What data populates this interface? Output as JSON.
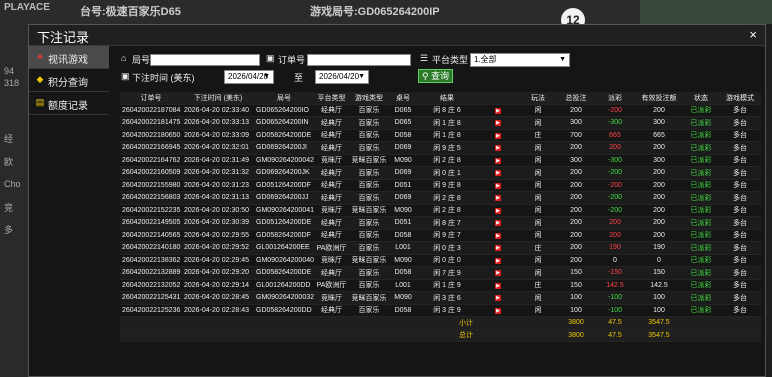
{
  "background": {
    "logo": "PLAYACE",
    "hall_label": "台号:极速百家乐D65",
    "game_label": "游戏局号:GD065264200IP",
    "ball_number": "12",
    "side_texts": [
      "94",
      "318",
      "经",
      "欧",
      "Cho",
      "竞",
      "多"
    ]
  },
  "dialog": {
    "title": "下注记录",
    "close_label": "×"
  },
  "nav": {
    "items": [
      {
        "label": "视讯游戏",
        "icon": "cards-icon",
        "active": true
      },
      {
        "label": "积分查询",
        "icon": "diamond-icon",
        "active": false
      },
      {
        "label": "额度记录",
        "icon": "document-icon",
        "active": false
      }
    ]
  },
  "filters": {
    "game_no_label": "局号",
    "order_no_label": "订单号",
    "platform_type_label": "平台类型",
    "platform_type_value": "1.全部",
    "bet_time_label": "下注时间 (美东)",
    "date_from": "2026/04/20",
    "to_label": "至",
    "date_to": "2026/04/20",
    "query_label": "查询"
  },
  "table": {
    "headers": [
      "订单号",
      "下注时间 (美东)",
      "局号",
      "平台类型",
      "游戏类型",
      "桌号",
      "结果",
      "",
      "玩法",
      "总投注",
      "派彩",
      "有效投注额",
      "状态",
      "游戏模式"
    ],
    "rows": [
      [
        "260420022187084",
        "2026-04-20 02:33:40",
        "GD065264200IO",
        "经典厅",
        "百家乐",
        "D065",
        "闲 8 庄 6",
        "▶",
        "闲",
        "200",
        "-200",
        "200",
        "已派彩",
        "多台",
        "r"
      ],
      [
        "260420022181475",
        "2026-04-20 02:33:13",
        "GD065264200IN",
        "经典厅",
        "百家乐",
        "D065",
        "闲 1 庄 8",
        "▶",
        "闲",
        "300",
        "-300",
        "300",
        "已派彩",
        "多台",
        "g"
      ],
      [
        "260420022180650",
        "2026-04-20 02:33:09",
        "GD058264200DE",
        "经典厅",
        "百家乐",
        "D058",
        "闲 1 庄 8",
        "▶",
        "庄",
        "700",
        "665",
        "665",
        "已派彩",
        "多台",
        "r"
      ],
      [
        "260420022166945",
        "2026-04-20 02:32:01",
        "GD069264200JI",
        "经典厅",
        "百家乐",
        "D069",
        "闲 9 庄 5",
        "▶",
        "闲",
        "200",
        "200",
        "200",
        "已派彩",
        "多台",
        "r"
      ],
      [
        "260420022164762",
        "2026-04-20 02:31:49",
        "GM090264200042",
        "竞眯厅",
        "竞眯百家乐",
        "M090",
        "闲 2 庄 8",
        "▶",
        "闲",
        "300",
        "-300",
        "300",
        "已派彩",
        "多台",
        "g"
      ],
      [
        "260420022160509",
        "2026-04-20 02:31:32",
        "GD069264200JK",
        "经典厅",
        "百家乐",
        "D069",
        "闲 0 庄 1",
        "▶",
        "闲",
        "200",
        "-200",
        "200",
        "已派彩",
        "多台",
        "g"
      ],
      [
        "260420022155980",
        "2026-04-20 02:31:23",
        "GD051264200DF",
        "经典厅",
        "百家乐",
        "D051",
        "闲 9 庄 8",
        "▶",
        "闲",
        "200",
        "-200",
        "200",
        "已派彩",
        "多台",
        "r"
      ],
      [
        "260420022156803",
        "2026-04-20 02:31:13",
        "GD069264200JJ",
        "经典厅",
        "百家乐",
        "D069",
        "闲 2 庄 8",
        "▶",
        "闲",
        "200",
        "-200",
        "200",
        "已派彩",
        "多台",
        "g"
      ],
      [
        "260420022152235",
        "2026-04-20 02:30:50",
        "GM090264200041",
        "竞眯厅",
        "竞眯百家乐",
        "M090",
        "闲 2 庄 8",
        "▶",
        "闲",
        "200",
        "-200",
        "200",
        "已派彩",
        "多台",
        "g"
      ],
      [
        "260420022149505",
        "2026-04-20 02:30:39",
        "GD051264200DE",
        "经典厅",
        "百家乐",
        "D051",
        "闲 8 庄 7",
        "▶",
        "闲",
        "200",
        "200",
        "200",
        "已派彩",
        "多台",
        "r"
      ],
      [
        "260420022140565",
        "2026-04-20 02:29:55",
        "GD058264200DF",
        "经典厅",
        "百家乐",
        "D058",
        "闲 9 庄 7",
        "▶",
        "闲",
        "200",
        "200",
        "200",
        "已派彩",
        "多台",
        "r"
      ],
      [
        "260420022140180",
        "2026-04-20 02:29:52",
        "GL001264200EE",
        "PA欧洲厅",
        "百家乐",
        "L001",
        "闲 0 庄 3",
        "▶",
        "庄",
        "200",
        "190",
        "190",
        "已派彩",
        "多台",
        "r"
      ],
      [
        "260420022138362",
        "2026-04-20 02:29:45",
        "GM090264200040",
        "竞眯厅",
        "竞眯百家乐",
        "M090",
        "闲 0 庄 0",
        "▶",
        "闲",
        "200",
        "0",
        "0",
        "已派彩",
        "多台",
        "n"
      ],
      [
        "260420022132889",
        "2026-04-20 02:29:20",
        "GD058264200DE",
        "经典厅",
        "百家乐",
        "D058",
        "闲 7 庄 9",
        "▶",
        "闲",
        "150",
        "-150",
        "150",
        "已派彩",
        "多台",
        "r"
      ],
      [
        "260420022132052",
        "2026-04-20 02:29:14",
        "GL001264200DD",
        "PA欧洲厅",
        "百家乐",
        "L001",
        "闲 1 庄 9",
        "▶",
        "庄",
        "150",
        "142.5",
        "142.5",
        "已派彩",
        "多台",
        "r"
      ],
      [
        "260420022125431",
        "2026-04-20 02:28:45",
        "GM090264200032",
        "竞眯厅",
        "竞眯百家乐",
        "M090",
        "闲 3 庄 6",
        "▶",
        "闲",
        "100",
        "-100",
        "100",
        "已派彩",
        "多台",
        "g"
      ],
      [
        "260420022125236",
        "2026-04-20 02:28:43",
        "GD058264200DD",
        "经典厅",
        "百家乐",
        "D058",
        "闲 3 庄 9",
        "▶",
        "闲",
        "100",
        "-100",
        "100",
        "已派彩",
        "多台",
        "g"
      ]
    ],
    "subtotal": {
      "label": "小计",
      "total_bet": "3800",
      "payout": "47.5",
      "valid_bet": "3547.5"
    },
    "total": {
      "label": "总计",
      "total_bet": "3800",
      "payout": "47.5",
      "valid_bet": "3547.5"
    }
  },
  "colors": {
    "positive": "#44dd44",
    "negative": "#ff4444",
    "summary": "#f0c800"
  }
}
